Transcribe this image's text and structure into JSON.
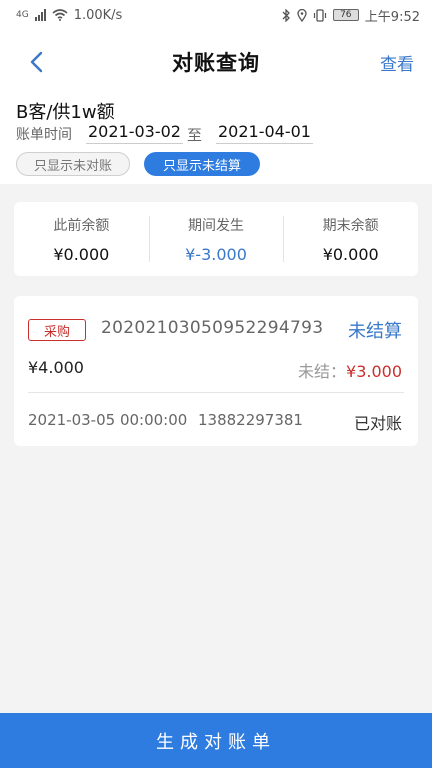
{
  "status_bar": {
    "network": "4G",
    "speed": "1.00K/s",
    "battery": "76",
    "time": "上午9:52"
  },
  "header": {
    "title": "对账查询",
    "action_label": "查看"
  },
  "filter": {
    "entity_name": "B客/供1w额",
    "date_label": "账单时间",
    "date_from": "2021-03-02",
    "date_sep": "至",
    "date_to": "2021-04-01",
    "chip_unreconciled": "只显示未对账",
    "chip_unsettled": "只显示未结算"
  },
  "summary": {
    "opening_label": "此前余额",
    "opening_value": "¥0.000",
    "period_label": "期间发生",
    "period_value": "¥-3.000",
    "closing_label": "期末余额",
    "closing_value": "¥0.000"
  },
  "records": [
    {
      "type": "采购",
      "order_no": "20202103050952294793",
      "status": "未结算",
      "amount": "¥4.000",
      "unsettled_label": "未结：",
      "unsettled_value": "¥3.000",
      "datetime": "2021-03-05 00:00:00",
      "phone": "13882297381",
      "reconcile_status": "已对账"
    }
  ],
  "footer": {
    "generate_label": "生成对账单"
  },
  "colors": {
    "accent": "#2f7ce0",
    "link_blue": "#3a78c9",
    "danger": "#c8302e"
  }
}
